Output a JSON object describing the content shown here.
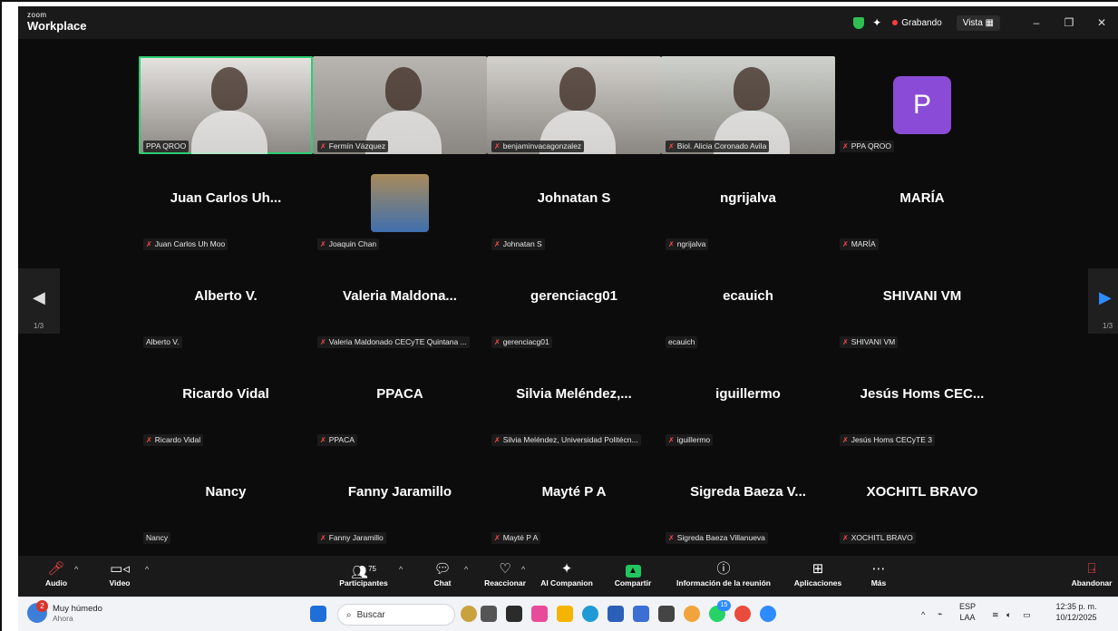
{
  "app": {
    "brand_small": "zoom",
    "brand": "Workplace"
  },
  "titlebar": {
    "recording_label": "Grabando",
    "view_label": "Vista",
    "view_icon": "grid-icon",
    "window_controls": [
      "–",
      "❐",
      "✕"
    ]
  },
  "nav": {
    "prev_page": "1/3",
    "next_page": "1/3"
  },
  "tiles": [
    {
      "name": "",
      "label": "PPA QROO",
      "muted": false,
      "type": "video",
      "bg": "#e6e4e1",
      "active": true
    },
    {
      "name": "",
      "label": "Fermín Vázquez",
      "muted": true,
      "type": "video",
      "bg": "#b9b6b1"
    },
    {
      "name": "",
      "label": "benjaminvacagonzalez",
      "muted": true,
      "type": "video",
      "bg": "#d3d1cc"
    },
    {
      "name": "",
      "label": "Biol. Alicia Coronado Avila",
      "muted": true,
      "type": "video",
      "bg": "#cfd3cd"
    },
    {
      "name": "",
      "label": "PPA QROO",
      "muted": true,
      "type": "avatar",
      "avatar_letter": "P"
    },
    {
      "name": "Juan Carlos Uh...",
      "label": "Juan Carlos Uh Moo",
      "muted": true,
      "type": "name"
    },
    {
      "name": "",
      "label": "Joaquin Chan",
      "muted": true,
      "type": "photo"
    },
    {
      "name": "Johnatan S",
      "label": "Johnatan S",
      "muted": true,
      "type": "name"
    },
    {
      "name": "ngrijalva",
      "label": "ngrijalva",
      "muted": true,
      "type": "name"
    },
    {
      "name": "MARÍA",
      "label": "MARÍA",
      "muted": true,
      "type": "name"
    },
    {
      "name": "Alberto V.",
      "label": "Alberto V.",
      "muted": false,
      "type": "name"
    },
    {
      "name": "Valeria Maldona...",
      "label": "Valeria Maldonado CECyTE Quintana ...",
      "muted": true,
      "type": "name"
    },
    {
      "name": "gerenciacg01",
      "label": "gerenciacg01",
      "muted": true,
      "type": "name"
    },
    {
      "name": "ecauich",
      "label": "ecauich",
      "muted": false,
      "type": "name"
    },
    {
      "name": "SHIVANI VM",
      "label": "SHIVANI VM",
      "muted": true,
      "type": "name"
    },
    {
      "name": "Ricardo Vidal",
      "label": "Ricardo Vidal",
      "muted": true,
      "type": "name"
    },
    {
      "name": "PPACA",
      "label": "PPACA",
      "muted": true,
      "type": "name"
    },
    {
      "name": "Silvia Meléndez,...",
      "label": "Silvia Meléndez, Universidad Politécn...",
      "muted": true,
      "type": "name"
    },
    {
      "name": "iguillermo",
      "label": "iguillermo",
      "muted": true,
      "type": "name"
    },
    {
      "name": "Jesús Homs CEC...",
      "label": "Jesús Homs CECyTE 3",
      "muted": true,
      "type": "name"
    },
    {
      "name": "Nancy",
      "label": "Nancy",
      "muted": false,
      "type": "name"
    },
    {
      "name": "Fanny Jaramillo",
      "label": "Fanny Jaramillo",
      "muted": true,
      "type": "name"
    },
    {
      "name": "Mayté P A",
      "label": "Mayté P A",
      "muted": true,
      "type": "name"
    },
    {
      "name": "Sigreda Baeza V...",
      "label": "Sigreda Baeza Villanueva",
      "muted": true,
      "type": "name"
    },
    {
      "name": "XOCHITL BRAVO",
      "label": "XOCHITL BRAVO",
      "muted": true,
      "type": "name"
    }
  ],
  "toolbar": {
    "audio": "Audio",
    "video": "Video",
    "participants": "Participantes",
    "participants_count": "75",
    "chat": "Chat",
    "react": "Reaccionar",
    "companion": "AI Companion",
    "share": "Compartir",
    "meeting_info": "Información de la reunión",
    "apps": "Aplicaciones",
    "more": "Más",
    "leave": "Abandonar"
  },
  "taskbar": {
    "weather_title": "Muy húmedo",
    "weather_sub": "Ahora",
    "weather_badge": "2",
    "search_placeholder": "Buscar",
    "whatsapp_badge": "15",
    "lang_top": "ESP",
    "lang_bottom": "LAA",
    "time": "12:35 p. m.",
    "date": "10/12/2025"
  },
  "colors": {
    "accent_green": "#2ecc71",
    "record_red": "#ff3b3b",
    "avatar_purple": "#8a4bd6",
    "nav_arrow_blue": "#2d8cff"
  }
}
